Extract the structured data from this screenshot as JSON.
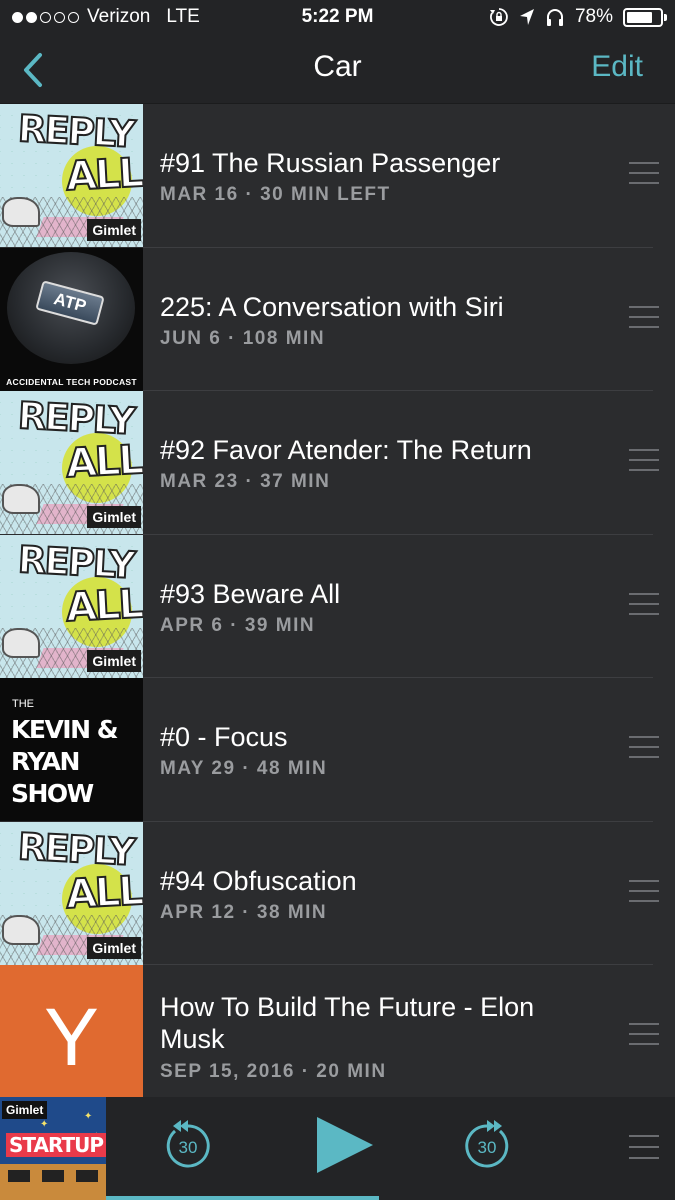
{
  "status_bar": {
    "carrier": "Verizon",
    "network": "LTE",
    "time": "5:22 PM",
    "battery": "78%",
    "battery_level": 0.78,
    "signal_bars_filled": 2,
    "signal_bars_total": 5,
    "icons": [
      "orientation-lock-icon",
      "location-arrow-icon",
      "headphones-icon",
      "battery-icon"
    ]
  },
  "nav": {
    "back_icon": "chevron-left-icon",
    "title": "Car",
    "edit_label": "Edit"
  },
  "episodes": [
    {
      "art": "reply-all",
      "title": "#91 The Russian Passenger",
      "meta": "MAR 16 · 30 MIN LEFT"
    },
    {
      "art": "atp",
      "title": "225: A Conversation with Siri",
      "meta": "JUN 6 · 108 MIN"
    },
    {
      "art": "reply-all",
      "title": "#92 Favor Atender: The Return",
      "meta": "MAR 23 · 37 MIN"
    },
    {
      "art": "reply-all",
      "title": "#93 Beware All",
      "meta": "APR 6 · 39 MIN"
    },
    {
      "art": "kevin-ryan",
      "title": "#0 - Focus",
      "meta": "MAY 29 · 48 MIN"
    },
    {
      "art": "reply-all",
      "title": "#94 Obfuscation",
      "meta": "APR 12 · 38 MIN"
    },
    {
      "art": "y-combinator",
      "title": "How To Build The Future - Elon Musk",
      "meta": "SEP 15, 2016 · 20 MIN"
    }
  ],
  "artwork_text": {
    "reply_all_line1": "REPLY",
    "reply_all_line2": "ALL",
    "gimlet": "Gimlet",
    "atp_badge": "ATP",
    "atp_caption": "ACCIDENTAL TECH PODCAST",
    "kr_the": "THE",
    "kr_lines": "KEVIN &\nRYAN\nSHOW",
    "yc_letter": "Y",
    "startup_label": "STARTUP"
  },
  "player": {
    "skip_back_seconds": "30",
    "skip_forward_seconds": "30",
    "progress_fraction": 0.48,
    "accent_color": "#5bb8c4"
  },
  "colors": {
    "background": "#2b2c2e",
    "bar": "#232426",
    "accent": "#5bb8c4",
    "meta_text": "#9a9c9f"
  }
}
